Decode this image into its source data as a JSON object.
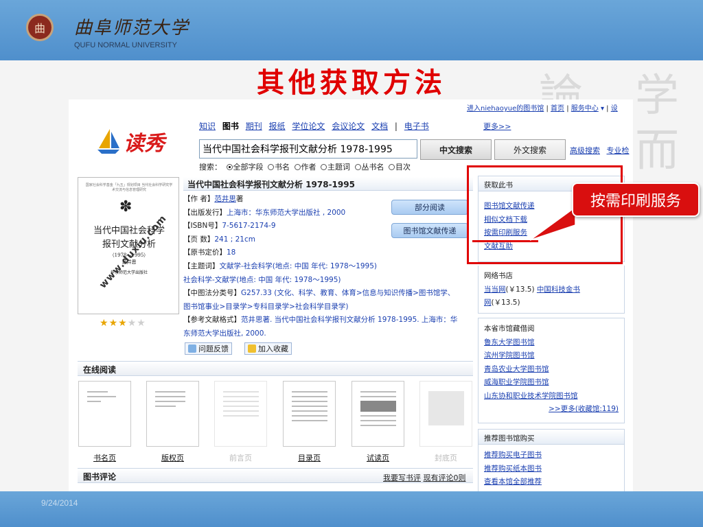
{
  "header": {
    "university_cn": "曲阜师范大学",
    "university_en": "QUFU NORMAL UNIVERSITY",
    "seal_glyph": "曲"
  },
  "slide": {
    "title": "其他获取方法",
    "date": "9/24/2014",
    "callout": "按需印刷服务",
    "watermark_chars": [
      "論",
      "学",
      "而"
    ]
  },
  "site": {
    "logo_text": "读秀",
    "top_links": {
      "login": "进入niehaoyue的图书馆",
      "home": "首页",
      "service": "服务中心",
      "sep": "|",
      "cut": "设"
    },
    "tabs": [
      "知识",
      "图书",
      "期刊",
      "报纸",
      "学位论文",
      "会议论文",
      "文档",
      "电子书"
    ],
    "active_tab": "图书",
    "more": "更多>>",
    "search_value": "当代中国社会科学报刊文献分析  1978-1995",
    "btn_cn_search": "中文搜索",
    "btn_en_search": "外文搜索",
    "advanced": "高级搜索",
    "expert": "专业检",
    "scope_label": "搜索：",
    "scope_options": [
      "全部字段",
      "书名",
      "作者",
      "主题词",
      "丛书名",
      "目次"
    ]
  },
  "book": {
    "title": "当代中国社会科学报刊文献分析 1978-1995",
    "cover": {
      "small_lines": "国家社会科学基金「九五」规划项目 当代社会科学研究学术交流与信息管理研究",
      "emblem": "✽",
      "title_line1": "当代中国社会科学",
      "title_line2": "报刊文献分析",
      "years": "（1978—1995）",
      "author": "范井恩",
      "publisher": "华东师范大学出版社",
      "watermark": "www.duxiu.com"
    },
    "rating": 3,
    "rating_max": 5,
    "meta": {
      "author_label": "【作 者】",
      "author": "范井思",
      "author_suffix": "著",
      "publish_label": "【出版发行】",
      "publish": "上海市：华东师范大学出版社 , 2000",
      "isbn_label": "【ISBN号】",
      "isbn": "7-5617-2174-9",
      "pages_label": "【页 数】",
      "pages": "241 ; 21cm",
      "price_label": "【原书定价】",
      "price": "18",
      "subject_label": "【主题词】",
      "subject": "文献学-社会科学(地点: 中国 年代: 1978～1995)",
      "subject2": "社会科学-文献学(地点: 中国 年代: 1978～1995)",
      "clc_label": "【中图法分类号】",
      "clc": "G257.33",
      "clc_desc": "(文化、科学、教育、体育>信息与知识传播>图书馆学、",
      "clc_desc2": "图书馆事业>目录学>专科目录学>社会科学目录学)",
      "cite_label": "【参考文献格式】",
      "cite": "范井思著. 当代中国社会科学报刊文献分析 1978-1995. 上海市：华",
      "cite2": "东师范大学出版社,",
      "cite_year": "2000."
    },
    "btn_partial": "部分阅读",
    "btn_delivery": "图书馆文献传递",
    "btn_feedback": "问题反馈",
    "btn_favorite": "加入收藏"
  },
  "online": {
    "header": "在线阅读",
    "thumbs": [
      {
        "label": "书名页",
        "available": true
      },
      {
        "label": "版权页",
        "available": true
      },
      {
        "label": "前言页",
        "available": false
      },
      {
        "label": "目录页",
        "available": true
      },
      {
        "label": "试读页",
        "available": true
      },
      {
        "label": "封底页",
        "available": false
      }
    ]
  },
  "review": {
    "header": "图书评论",
    "write": "我要写书评",
    "existing": "现有评论0则"
  },
  "side": {
    "obtain": {
      "header": "获取此书",
      "items": [
        "图书馆文献传递",
        "相似文档下载",
        "按需印刷服务",
        "文献互助"
      ]
    },
    "online_store": {
      "header": "网络书店",
      "line1_link": "当当网",
      "line1_price": "(￥13.5)",
      "line1_link2": "中国科技金书",
      "line2_link": "网",
      "line2_price": "(￥13.5)"
    },
    "province": {
      "header": "本省市馆藏借阅",
      "items": [
        "鲁东大学图书馆",
        "滨州学院图书馆",
        "青岛农业大学图书馆",
        "威海职业学院图书馆",
        "山东协和职业技术学院图书馆"
      ],
      "more": ">>更多(收藏馆:119)"
    },
    "recommend": {
      "header": "推荐图书馆购买",
      "items": [
        "推荐购买电子图书",
        "推荐购买纸本图书",
        "查看本馆全部推荐"
      ]
    }
  },
  "colors": {
    "band": "#5a98d2",
    "title_red": "#e00000",
    "link": "#1a3fb0",
    "duxiu_red": "#d91a1a"
  }
}
